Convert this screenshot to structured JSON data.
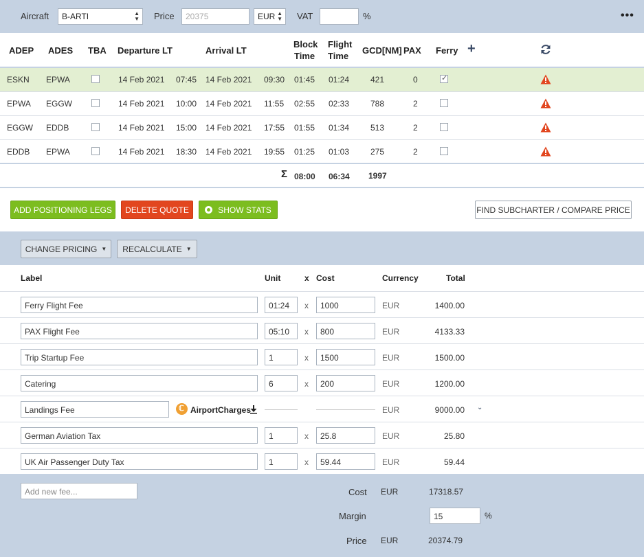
{
  "topbar": {
    "aircraft_label": "Aircraft",
    "aircraft_value": "B-ARTI",
    "price_label": "Price",
    "price_placeholder": "20375",
    "currency_value": "EUR",
    "vat_label": "VAT",
    "vat_value": "",
    "vat_unit": "%",
    "more_icon": "more-horizontal-icon"
  },
  "legs_table": {
    "headers": {
      "adep": "ADEP",
      "ades": "ADES",
      "tba": "TBA",
      "departure": "Departure LT",
      "arrival": "Arrival LT",
      "block_1": "Block",
      "block_2": "Time",
      "flight_1": "Flight",
      "flight_2": "Time",
      "gcd": "GCD[NM]",
      "pax": "PAX",
      "ferry": "Ferry"
    },
    "rows": [
      {
        "adep": "ESKN",
        "ades": "EPWA",
        "dep_date": "14 Feb 2021",
        "dep_time": "07:45",
        "arr_date": "14 Feb 2021",
        "arr_time": "09:30",
        "block": "01:45",
        "flight": "01:24",
        "gcd": "421",
        "pax": "0",
        "ferry": true,
        "tba": false
      },
      {
        "adep": "EPWA",
        "ades": "EGGW",
        "dep_date": "14 Feb 2021",
        "dep_time": "10:00",
        "arr_date": "14 Feb 2021",
        "arr_time": "11:55",
        "block": "02:55",
        "flight": "02:33",
        "gcd": "788",
        "pax": "2",
        "ferry": false,
        "tba": false
      },
      {
        "adep": "EGGW",
        "ades": "EDDB",
        "dep_date": "14 Feb 2021",
        "dep_time": "15:00",
        "arr_date": "14 Feb 2021",
        "arr_time": "17:55",
        "block": "01:55",
        "flight": "01:34",
        "gcd": "513",
        "pax": "2",
        "ferry": false,
        "tba": false
      },
      {
        "adep": "EDDB",
        "ades": "EPWA",
        "dep_date": "14 Feb 2021",
        "dep_time": "18:30",
        "arr_date": "14 Feb 2021",
        "arr_time": "19:55",
        "block": "01:25",
        "flight": "01:03",
        "gcd": "275",
        "pax": "2",
        "ferry": false,
        "tba": false
      }
    ],
    "totals": {
      "sigma": "Σ",
      "block": "08:00",
      "flight": "06:34",
      "gcd": "1997"
    }
  },
  "actions": {
    "add_positioning": "ADD POSITIONING LEGS",
    "delete_quote": "DELETE QUOTE",
    "show_stats": "SHOW STATS",
    "find_subcharter": "FIND SUBCHARTER / COMPARE PRICE"
  },
  "pricing_toolbar": {
    "change_pricing": "CHANGE PRICING",
    "recalculate": "RECALCULATE"
  },
  "fees_table": {
    "headers": {
      "label": "Label",
      "unit": "Unit",
      "x": "x",
      "cost": "Cost",
      "currency": "Currency",
      "total": "Total"
    },
    "rows": [
      {
        "label": "Ferry Flight Fee",
        "unit": "01:24",
        "x": "x",
        "cost": "1000",
        "currency": "EUR",
        "total": "1400.00"
      },
      {
        "label": "PAX Flight Fee",
        "unit": "05:10",
        "x": "x",
        "cost": "800",
        "currency": "EUR",
        "total": "4133.33"
      },
      {
        "label": "Trip Startup Fee",
        "unit": "1",
        "x": "x",
        "cost": "1500",
        "currency": "EUR",
        "total": "1500.00"
      },
      {
        "label": "Catering",
        "unit": "6",
        "x": "x",
        "cost": "200",
        "currency": "EUR",
        "total": "1200.00"
      },
      {
        "label": "Landings Fee",
        "provider": "AirportCharges",
        "currency": "EUR",
        "total": "9000.00"
      },
      {
        "label": "German Aviation Tax",
        "unit": "1",
        "x": "x",
        "cost": "25.8",
        "currency": "EUR",
        "total": "25.80"
      },
      {
        "label": "UK Air Passenger Duty Tax",
        "unit": "1",
        "x": "x",
        "cost": "59.44",
        "currency": "EUR",
        "total": "59.44"
      }
    ]
  },
  "summary": {
    "add_fee_placeholder": "Add new fee...",
    "cost_label": "Cost",
    "cost_currency": "EUR",
    "cost_value": "17318.57",
    "margin_label": "Margin",
    "margin_value": "15",
    "margin_unit": "%",
    "price_label": "Price",
    "price_currency": "EUR",
    "price_value": "20374.79"
  },
  "colors": {
    "band": "#c5d2e2",
    "highlight_row": "#e3efd2",
    "green": "#7cbd1f",
    "red": "#e2461f",
    "warning": "#e2461f"
  }
}
